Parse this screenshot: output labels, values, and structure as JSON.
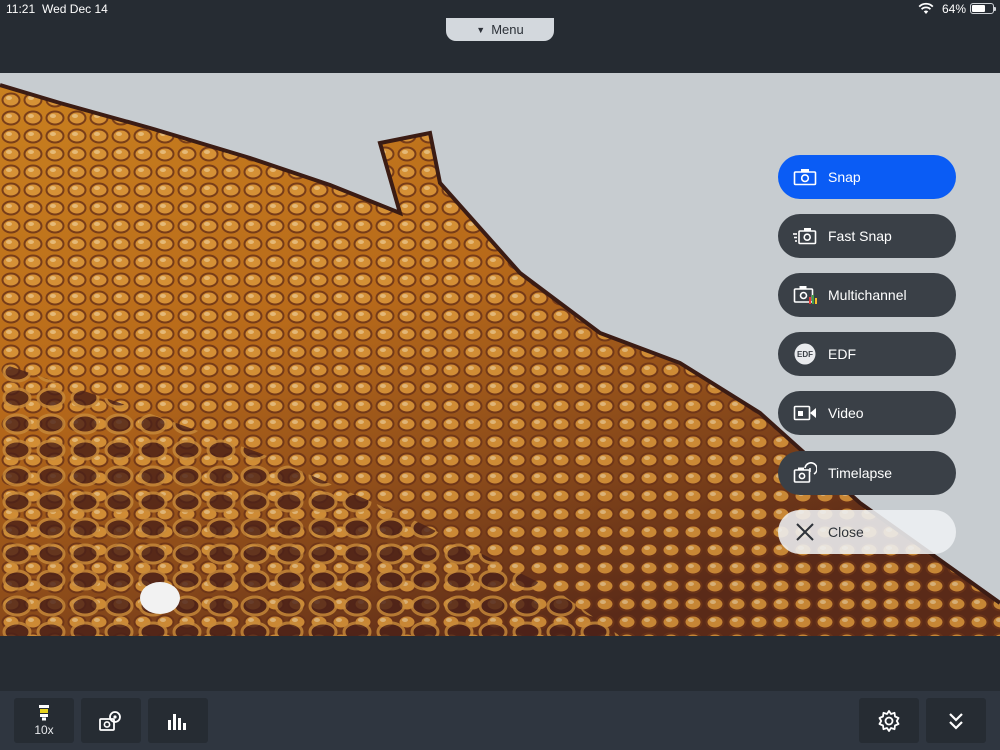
{
  "status_bar": {
    "time": "11:21",
    "date": "Wed Dec 14",
    "battery_percent": "64%",
    "battery_level": 0.64
  },
  "top_bar": {
    "menu_label": "Menu"
  },
  "capture_menu": {
    "items": [
      {
        "label": "Snap",
        "icon": "camera-icon",
        "active": true
      },
      {
        "label": "Fast Snap",
        "icon": "fast-camera-icon",
        "active": false
      },
      {
        "label": "Multichannel",
        "icon": "multichannel-icon",
        "active": false
      },
      {
        "label": "EDF",
        "icon": "edf-icon",
        "icon_text": "EDF",
        "active": false
      },
      {
        "label": "Video",
        "icon": "video-camera-icon",
        "active": false
      },
      {
        "label": "Timelapse",
        "icon": "timelapse-icon",
        "active": false
      },
      {
        "label": "Close",
        "icon": "close-icon",
        "active": false
      }
    ]
  },
  "bottom_toolbar": {
    "objective_label": "10x",
    "objective_icon": "objective-lens-icon",
    "camera_settings_icon": "camera-settings-icon",
    "histogram_icon": "histogram-icon",
    "settings_icon": "gear-icon",
    "collapse_icon": "double-chevron-down-icon"
  },
  "colors": {
    "accent": "#0a5cf5",
    "background": "#262c33",
    "button": "#3a4047",
    "toolbar": "#2f3640"
  }
}
